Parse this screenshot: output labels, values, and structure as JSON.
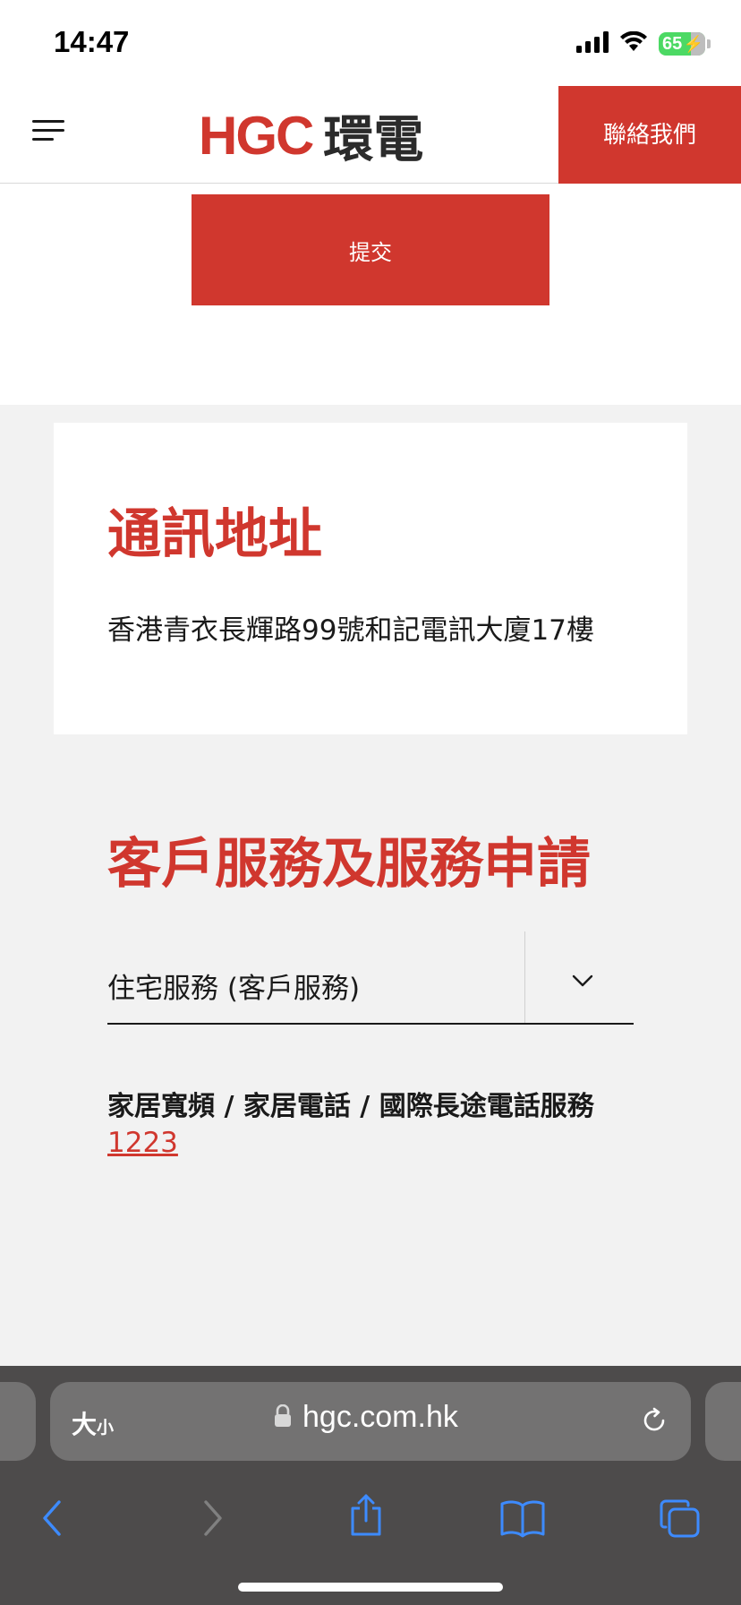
{
  "status_bar": {
    "time": "14:47",
    "battery_level": "65",
    "icons": [
      "signal-icon",
      "wifi-icon",
      "battery-charging-icon"
    ]
  },
  "header": {
    "logo_mark": "HGC",
    "logo_chinese": "環電",
    "contact_label": "聯絡我們",
    "menu_icon": "hamburger-menu-icon"
  },
  "form": {
    "submit_label": "提交"
  },
  "address": {
    "title": "通訊地址",
    "text": "香港青衣長輝路99號和記電訊大廈17樓"
  },
  "customer_service": {
    "title": "客戶服務及服務申請",
    "select_value": "住宅服務 (客戶服務)",
    "hotline_label": "家居寬頻 / 家居電話 / 國際長途電話服務",
    "hotline_number": "1223"
  },
  "browser": {
    "text_size_large": "大",
    "text_size_small": "小",
    "url": "hgc.com.hk",
    "toolbar_icons": [
      "back-icon",
      "forward-icon",
      "share-icon",
      "bookmarks-icon",
      "tabs-icon"
    ]
  },
  "colors": {
    "brand_red": "#d0372e",
    "page_background": "#f2f2f2",
    "browser_chrome": "#4d4b4b"
  }
}
